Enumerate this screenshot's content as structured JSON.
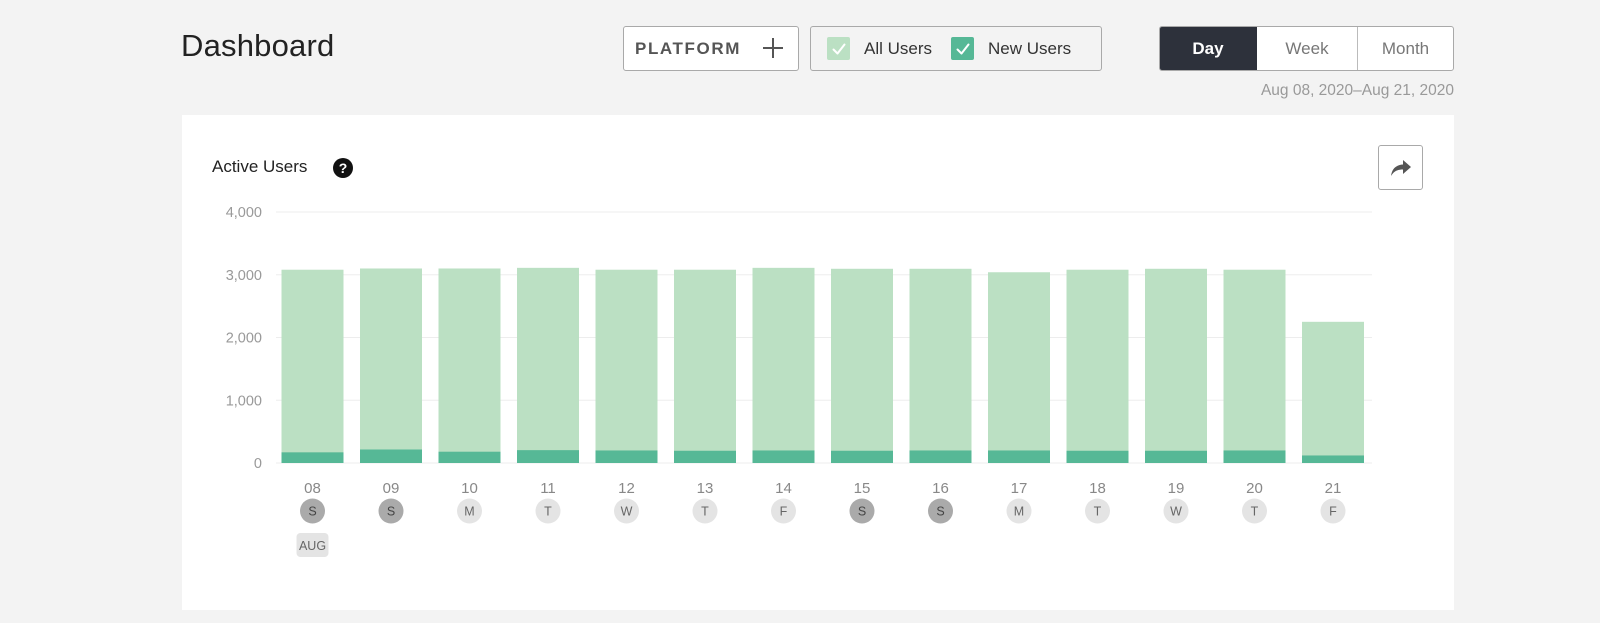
{
  "header": {
    "title": "Dashboard"
  },
  "platform": {
    "label": "PLATFORM"
  },
  "legend": {
    "all_users": {
      "label": "All Users",
      "color": "#bbe0c3",
      "checked": true
    },
    "new_users": {
      "label": "New Users",
      "color": "#56b896",
      "checked": true
    }
  },
  "period": {
    "options": [
      "Day",
      "Week",
      "Month"
    ],
    "selected": "Day"
  },
  "date_range": "Aug 08, 2020–Aug 21, 2020",
  "card": {
    "title": "Active Users"
  },
  "colors": {
    "all_users_bar": "#bbe0c3",
    "new_users_bar": "#56b896",
    "weekend_badge": "#aaaaaa",
    "weekday_badge": "#e4e4e4",
    "month_badge": "#e4e4e4"
  },
  "chart_data": {
    "type": "bar",
    "stacked": false,
    "title": "Active Users",
    "categories": [
      "08",
      "09",
      "10",
      "11",
      "12",
      "13",
      "14",
      "15",
      "16",
      "17",
      "18",
      "19",
      "20",
      "21"
    ],
    "weekdays": [
      "S",
      "S",
      "M",
      "T",
      "W",
      "T",
      "F",
      "S",
      "S",
      "M",
      "T",
      "W",
      "T",
      "F"
    ],
    "weekend": [
      true,
      true,
      false,
      false,
      false,
      false,
      false,
      true,
      true,
      false,
      false,
      false,
      false,
      false
    ],
    "month_label": "AUG",
    "series": [
      {
        "name": "All Users",
        "values": [
          3080,
          3100,
          3100,
          3110,
          3080,
          3080,
          3110,
          3095,
          3095,
          3040,
          3080,
          3095,
          3080,
          2250
        ]
      },
      {
        "name": "New Users",
        "values": [
          170,
          215,
          180,
          205,
          200,
          195,
          200,
          195,
          200,
          200,
          195,
          195,
          200,
          120
        ]
      }
    ],
    "yticks": [
      0,
      1000,
      2000,
      3000,
      4000
    ],
    "ytick_labels": [
      "0",
      "1,000",
      "2,000",
      "3,000",
      "4,000"
    ],
    "ylim": [
      0,
      4000
    ],
    "grid": true
  }
}
